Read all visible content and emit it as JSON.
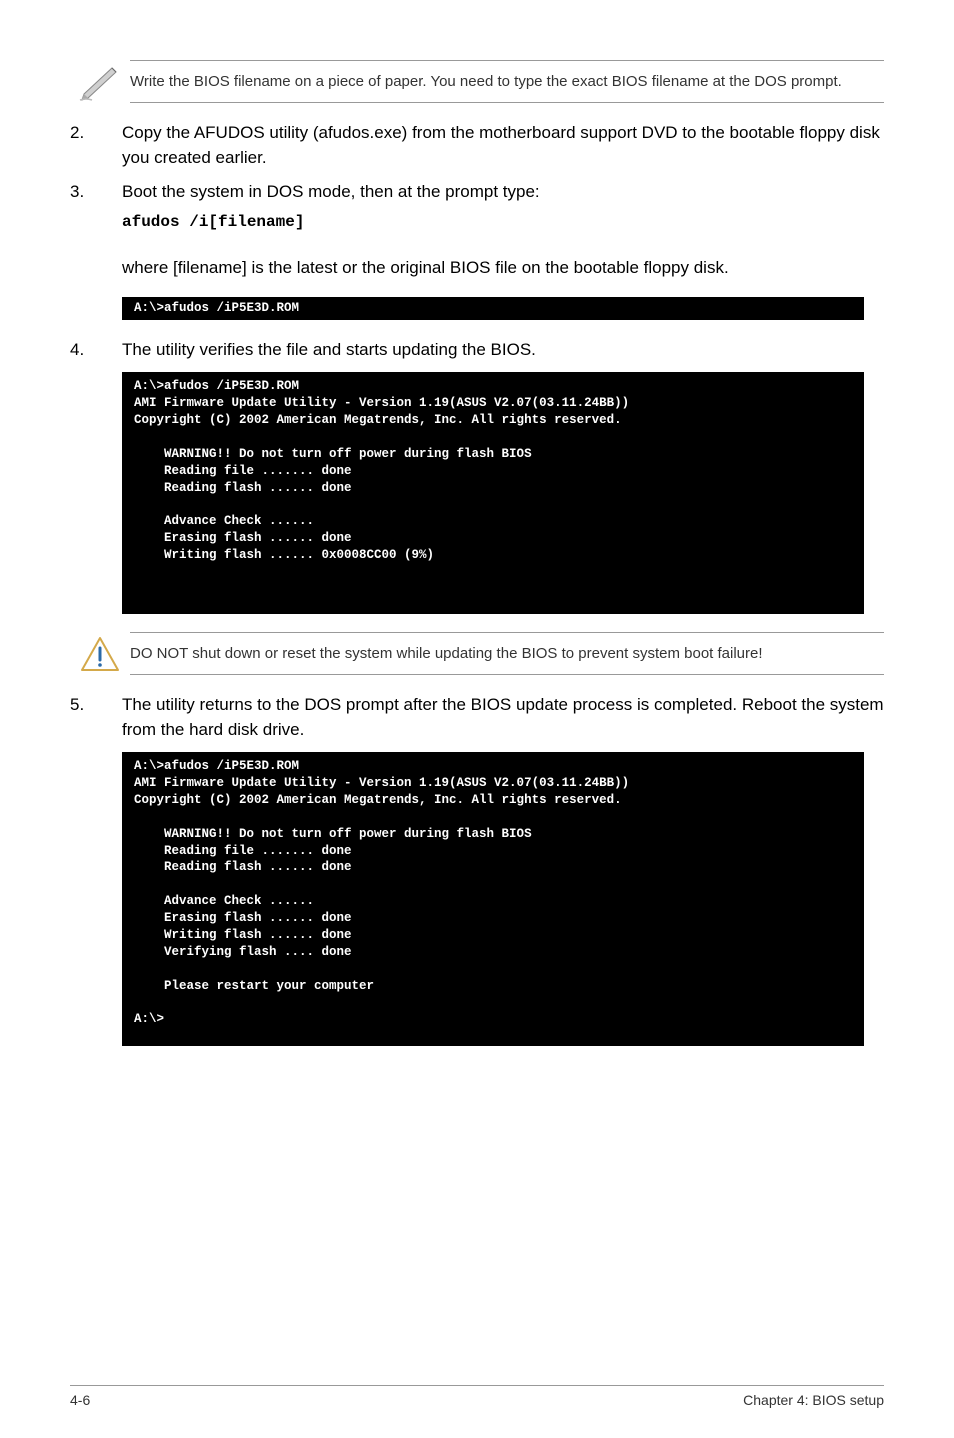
{
  "note1": "Write the BIOS filename on a piece of paper. You need to type the exact BIOS filename at the DOS prompt.",
  "step2": {
    "num": "2.",
    "text": "Copy the AFUDOS utility (afudos.exe) from the motherboard support DVD to the bootable floppy disk you created earlier."
  },
  "step3": {
    "num": "3.",
    "text": "Boot the system in DOS mode, then at the prompt type:",
    "code": "afudos /i[filename]"
  },
  "subpara3": "where [filename] is the latest or the original BIOS file on the bootable floppy disk.",
  "terminal1": "A:\\>afudos /iP5E3D.ROM",
  "step4": {
    "num": "4.",
    "text": "The utility verifies the file and starts updating the BIOS."
  },
  "terminal2": "A:\\>afudos /iP5E3D.ROM\nAMI Firmware Update Utility - Version 1.19(ASUS V2.07(03.11.24BB))\nCopyright (C) 2002 American Megatrends, Inc. All rights reserved.\n\n    WARNING!! Do not turn off power during flash BIOS\n    Reading file ....... done\n    Reading flash ...... done\n\n    Advance Check ......\n    Erasing flash ...... done\n    Writing flash ...... 0x0008CC00 (9%)",
  "warning": "DO NOT shut down or reset the system while updating the BIOS to prevent system boot failure!",
  "step5": {
    "num": "5.",
    "text": "The utility returns to the DOS prompt after the BIOS update process is completed. Reboot the system from the hard disk drive."
  },
  "terminal3": "A:\\>afudos /iP5E3D.ROM\nAMI Firmware Update Utility - Version 1.19(ASUS V2.07(03.11.24BB))\nCopyright (C) 2002 American Megatrends, Inc. All rights reserved.\n\n    WARNING!! Do not turn off power during flash BIOS\n    Reading file ....... done\n    Reading flash ...... done\n\n    Advance Check ......\n    Erasing flash ...... done\n    Writing flash ...... done\n    Verifying flash .... done\n\n    Please restart your computer\n\nA:\\>",
  "footer": {
    "left": "4-6",
    "right": "Chapter 4: BIOS setup"
  }
}
